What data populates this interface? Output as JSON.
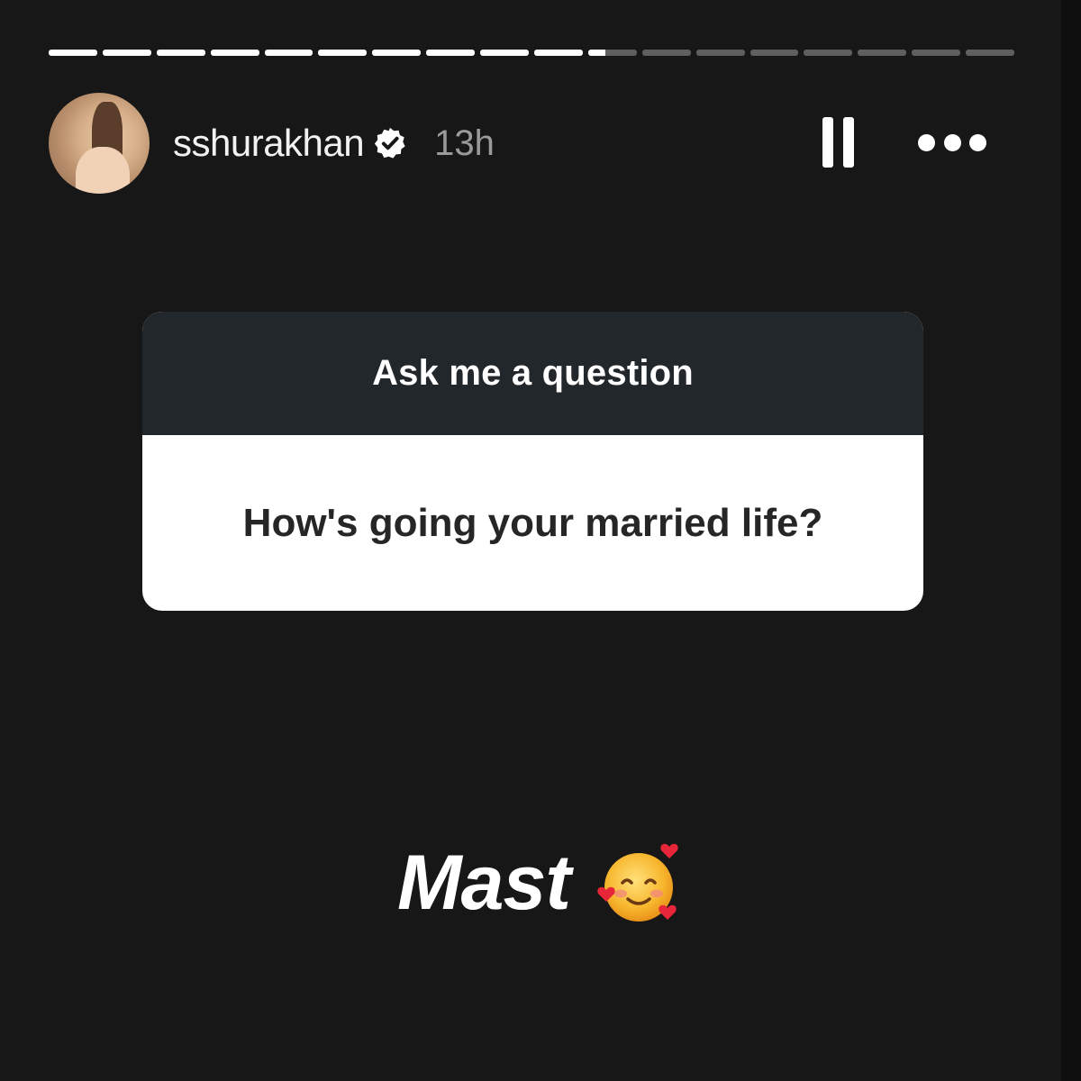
{
  "story": {
    "progress": {
      "segments_total": 18,
      "segments_complete": 10,
      "current_segment_fraction": 0.35
    },
    "header": {
      "username": "sshurakhan",
      "time_ago": "13h",
      "verified_icon": "verified-badge-icon",
      "pause_icon": "pause-icon",
      "more_icon": "more-options-icon"
    },
    "question_sticker": {
      "title": "Ask me a question",
      "question": "How's going your married life?"
    },
    "answer": {
      "text": "Mast",
      "emoji": "smiling-face-with-hearts-emoji"
    }
  },
  "colors": {
    "background": "#171717",
    "sticker_header": "#22272c",
    "progress_active": "#ffffff",
    "progress_inactive": "#5f5f5f",
    "time_text": "#9a9a9a"
  }
}
